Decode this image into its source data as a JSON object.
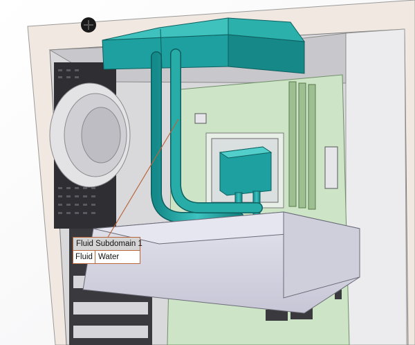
{
  "callout": {
    "title": "Fluid Subdomain 1",
    "property": "Fluid",
    "value": "Water"
  },
  "colors": {
    "background": "#ffffff",
    "case_wall": "#f1e9e1",
    "water_body": "#1fa0a0",
    "motherboard": "#cde5c6",
    "leader_line": "#b9653c",
    "radiator_block": "#d8d8e6"
  },
  "icons": {
    "screw": "screw-icon",
    "fan": "fan-icon"
  }
}
